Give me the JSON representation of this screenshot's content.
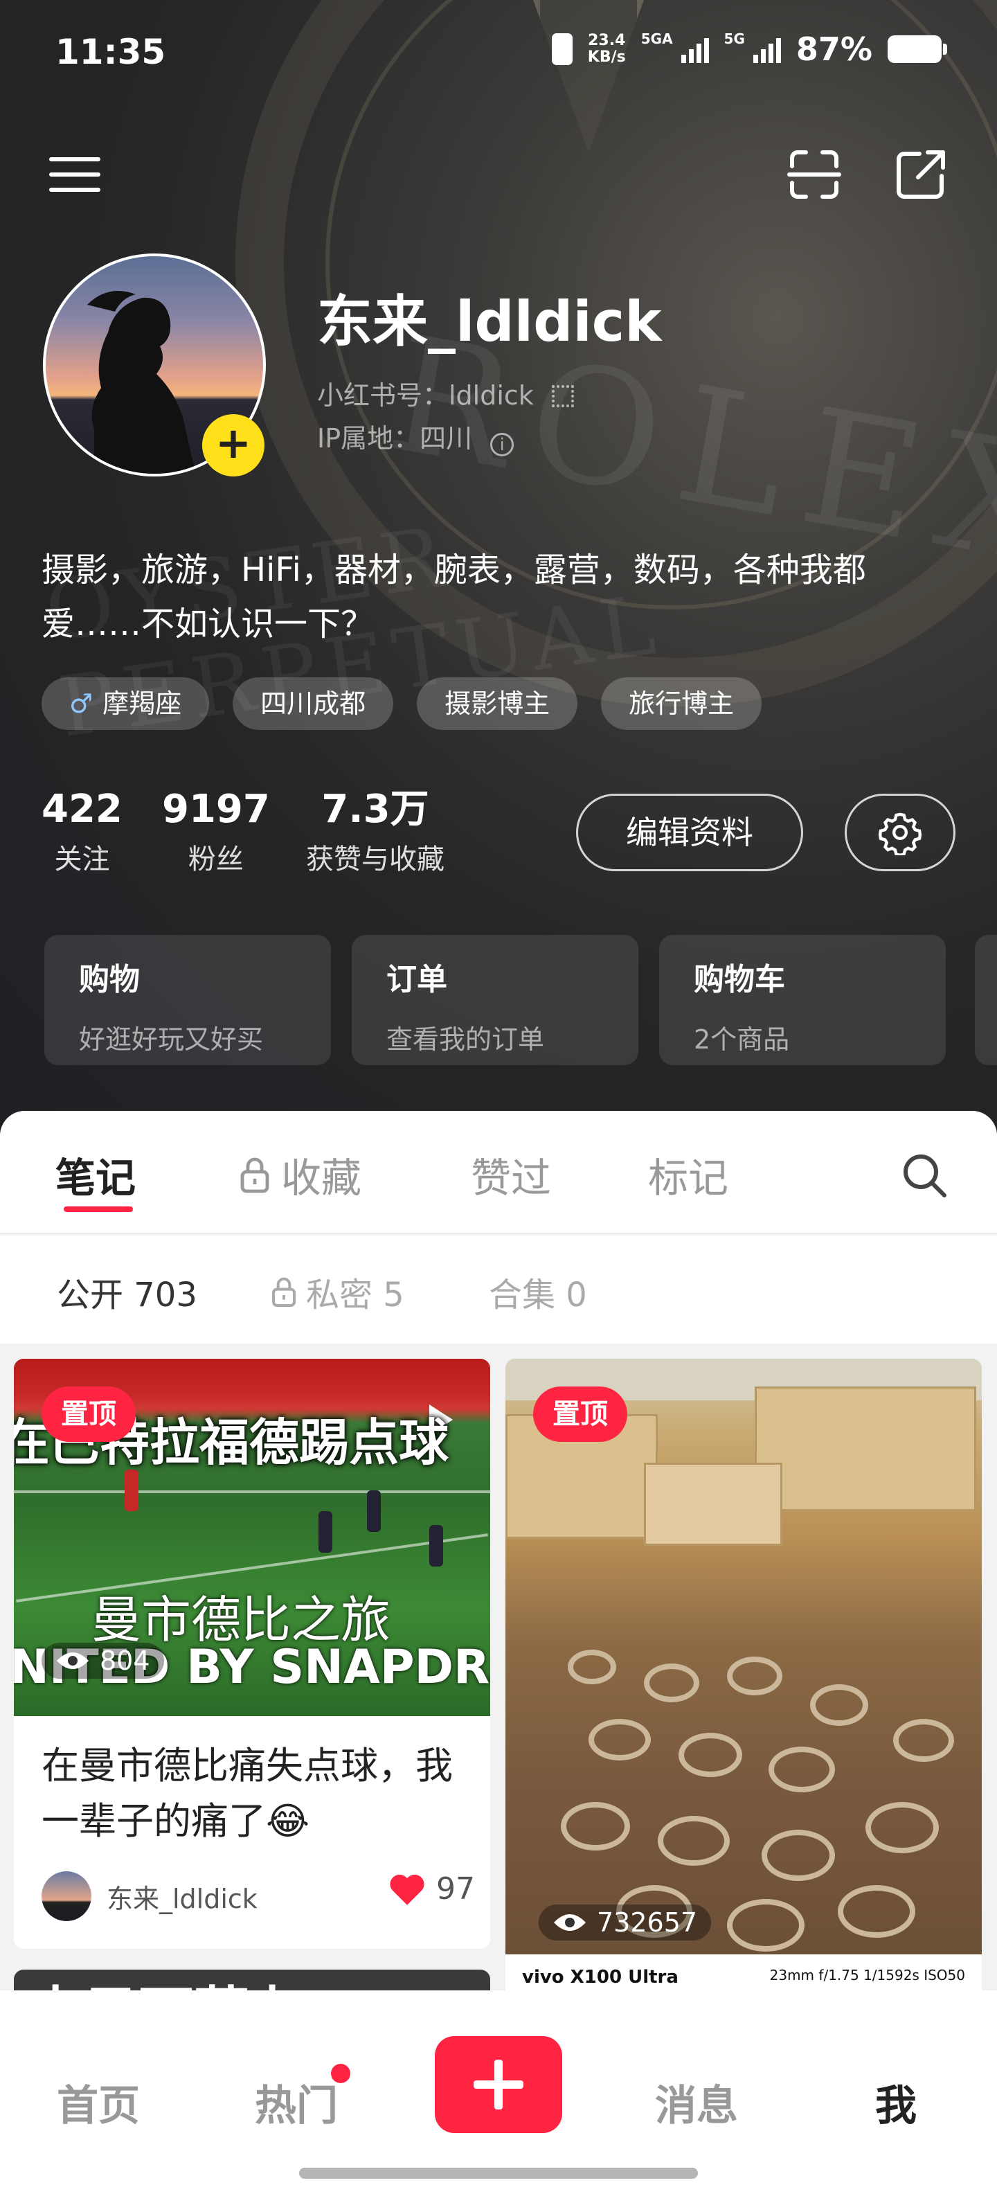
{
  "status_bar": {
    "time": "11:35",
    "net_speed_value": "23.4",
    "net_speed_unit": "KB/s",
    "sim1": "5GA",
    "sim2": "5G",
    "battery": "87%"
  },
  "profile": {
    "username": "东来_ldldick",
    "red_id": "小红书号：ldldick",
    "ip_location": "IP属地：四川",
    "bio": "摄影，旅游，HiFi，器材，腕表，露营，数码，各种我都爱……不如认识一下？",
    "tags": [
      {
        "icon": "male-icon",
        "label": "摩羯座"
      },
      {
        "label": "四川成都"
      },
      {
        "label": "摄影博主"
      },
      {
        "label": "旅行博主"
      }
    ],
    "stats": [
      {
        "value": "422",
        "label": "关注"
      },
      {
        "value": "9197",
        "label": "粉丝"
      },
      {
        "value": "7.3万",
        "label": "获赞与收藏"
      }
    ],
    "edit_button": "编辑资料"
  },
  "shortcuts": [
    {
      "title": "购物",
      "subtitle": "好逛好玩又好买"
    },
    {
      "title": "订单",
      "subtitle": "查看我的订单"
    },
    {
      "title": "购物车",
      "subtitle": "2个商品"
    }
  ],
  "tabs": [
    {
      "label": "笔记",
      "active": true
    },
    {
      "label": "收藏",
      "locked": true
    },
    {
      "label": "赞过"
    },
    {
      "label": "标记"
    }
  ],
  "subtabs": [
    {
      "label": "公开 703",
      "active": true
    },
    {
      "label": "私密 5",
      "locked": true
    },
    {
      "label": "合集 0"
    }
  ],
  "notes": [
    {
      "pinned_label": "置顶",
      "image_caption_top": "在巴特拉福德踢点球",
      "image_caption_mid": "曼市德比之旅",
      "image_caption_bottom": "NITED BY SNAPDRAGO",
      "views": "804",
      "title": "在曼市德比痛失点球，我一辈子的痛了😂",
      "author": "东来_ldldick",
      "likes": "97"
    },
    {
      "pinned_label": "置顶",
      "views": "732657",
      "camera_watermark": "vivo X100 Ultra",
      "camera_params": "23mm f/1.75 1/1592s ISO50"
    },
    {
      "image_caption_top": "水目雨薇丸"
    }
  ],
  "bottom_nav": [
    {
      "label": "首页"
    },
    {
      "label": "热门",
      "badge": true
    },
    {
      "label": "消息"
    },
    {
      "label": "我",
      "active": true
    }
  ],
  "colors": {
    "accent": "#ff2442",
    "add_badge": "#ffe01b",
    "header_bg": "#262628"
  }
}
